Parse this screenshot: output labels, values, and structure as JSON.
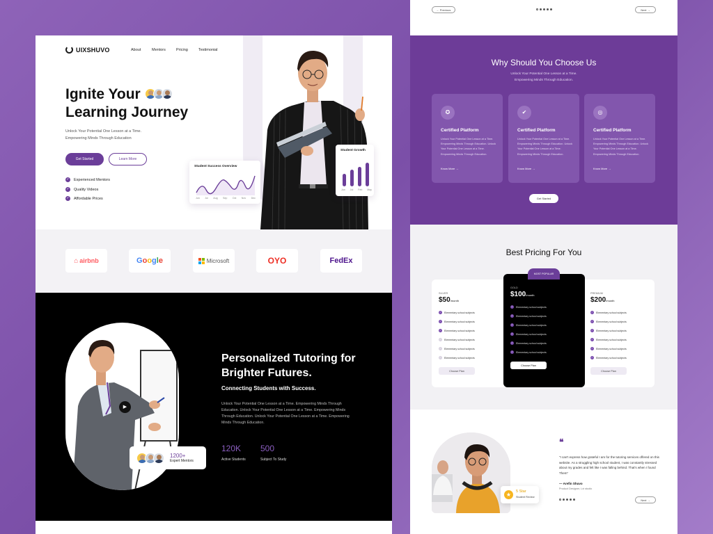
{
  "brand": {
    "name": "UIXSHUVO"
  },
  "nav": {
    "about": "About",
    "mentors": "Mentors",
    "pricing": "Pricing",
    "testimonial": "Testimonial"
  },
  "hero": {
    "title_line1": "Ignite Your",
    "title_line2": "Learning Journey",
    "subtitle_line1": "Unlock Your Potential One Lesson at a Time.",
    "subtitle_line2": "Empowering Minds Through Education",
    "primary_cta": "Get Started",
    "secondary_cta": "Learn More",
    "features": [
      "Experienced Mentors",
      "Quality Videos",
      "Affordable Prices"
    ]
  },
  "cards": {
    "overview": {
      "title": "Student Success Overview",
      "months": [
        "Jun",
        "Jul",
        "Aug",
        "Sep",
        "Oct",
        "Nov",
        "Dec"
      ]
    },
    "growth": {
      "title": "Student Growth",
      "months": [
        "Jun",
        "Jul",
        "Feb",
        "May"
      ],
      "levels": [
        0.45,
        0.6,
        0.7,
        0.85
      ]
    }
  },
  "partners": [
    "airbnb",
    "Google",
    "Microsoft",
    "OYO",
    "FedEx"
  ],
  "tutoring": {
    "title": "Personalized Tutoring for Brighter Futures.",
    "subtitle": "Connecting Students with Success.",
    "body": "Unlock Your Potential One Lesson at a Time. Empowering Minds Through Education. Unlock Your Potential One Lesson at a Time. Empowering Minds Through Education. Unlock Your Potential One Lesson at a Time. Empowering Minds Through Education.",
    "stats": [
      {
        "value": "120K",
        "label": "Active Students"
      },
      {
        "value": "500",
        "label": "Subject To Study"
      }
    ],
    "mentors_count": "1200+",
    "mentors_label": "Expert Mentors"
  },
  "pager": {
    "prev": "Previous",
    "next": "Next"
  },
  "why": {
    "title": "Why Should You Choose Us",
    "subtitle_line1": "Unlock Your Potential One Lesson at a Time.",
    "subtitle_line2": "Empowering Minds Through Education.",
    "cards": [
      {
        "title": "Certified Platform",
        "body": "Unlock Your Potential One Lesson at a Time. Empowering Minds Through Education. Unlock Your Potential One Lesson at a Time. Empowering Minds Through Education.",
        "link": "Know More"
      },
      {
        "title": "Certified Platform",
        "body": "Unlock Your Potential One Lesson at a Time. Empowering Minds Through Education. Unlock Your Potential One Lesson at a Time. Empowering Minds Through Education.",
        "link": "Know More"
      },
      {
        "title": "Certified Platform",
        "body": "Unlock Your Potential One Lesson at a Time. Empowering Minds Through Education. Unlock Your Potential One Lesson at a Time. Empowering Minds Through Education.",
        "link": "Know More"
      }
    ],
    "cta": "Get Started"
  },
  "pricing": {
    "title": "Best Pricing For You",
    "badge": "MOST POPULAR",
    "per": "/month",
    "item_text": "Elementary school subjects",
    "plans": [
      {
        "name": "SILVER",
        "price": "$50",
        "cta": "Choose Plan"
      },
      {
        "name": "GOLD",
        "price": "$100",
        "cta": "Choose Plan"
      },
      {
        "name": "PREMIUM",
        "price": "$200",
        "cta": "Choose Plan"
      }
    ]
  },
  "testimonial": {
    "quote": "“I can't express how grateful I am for the tutoring services offered on this website. As a struggling high school student, I was constantly stressed about my grades and felt like I was falling behind. That's when I found Them”",
    "author": "— Arefin Shuvo",
    "role": "Product Designer, Lxi studio",
    "rating": "5 Star",
    "rating_label": "Student Review",
    "next": "Next"
  },
  "colors": {
    "accent": "#6b3e99",
    "background": "#8a5db7",
    "dark": "#000000"
  }
}
